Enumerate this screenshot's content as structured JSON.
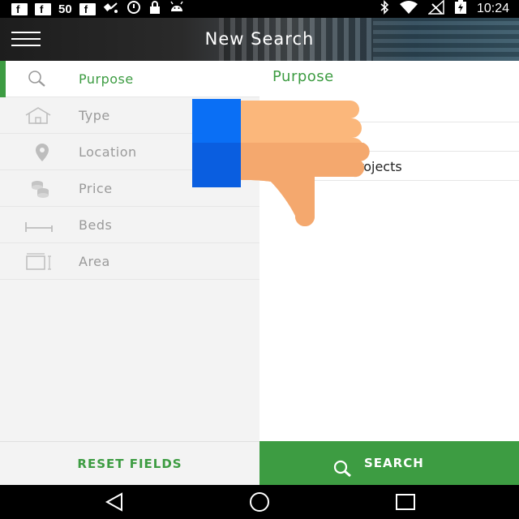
{
  "status_bar": {
    "left_icons": [
      "facebook-icon",
      "facebook-icon",
      "facebook-icon",
      "satellite-icon",
      "data-saver-icon",
      "lock-icon",
      "android-icon"
    ],
    "fb_letter": "f",
    "signal_count": "50",
    "right_icons": [
      "bluetooth-icon",
      "wifi-icon",
      "no-signal-icon",
      "battery-charging-icon"
    ],
    "time": "10:24"
  },
  "app_bar": {
    "title": "New Search",
    "menu_icon": "hamburger-menu-icon"
  },
  "sidebar": {
    "active_color": "#3d9c42",
    "items": [
      {
        "label": "Purpose",
        "icon": "search-icon",
        "active": true
      },
      {
        "label": "Type",
        "icon": "house-icon",
        "active": false
      },
      {
        "label": "Location",
        "icon": "location-pin-icon",
        "active": false
      },
      {
        "label": "Price",
        "icon": "coins-icon",
        "active": false
      },
      {
        "label": "Beds",
        "icon": "bed-icon",
        "active": false
      },
      {
        "label": "Area",
        "icon": "area-icon",
        "active": false
      }
    ]
  },
  "panel": {
    "title": "Purpose",
    "options": [
      "",
      "",
      "rojects"
    ]
  },
  "overlay": {
    "icon": "thumbs-down-icon",
    "colors": {
      "blue": "#0066ff",
      "skin": "#fbb77b"
    }
  },
  "actions": {
    "reset_label": "RESET FIELDS",
    "search_label": "SEARCH",
    "search_icon": "search-icon"
  },
  "nav_bar": {
    "buttons": [
      "back-icon",
      "home-icon",
      "recents-icon"
    ]
  },
  "colors": {
    "accent": "#3d9c42",
    "panel_bg": "#f3f3f3"
  }
}
